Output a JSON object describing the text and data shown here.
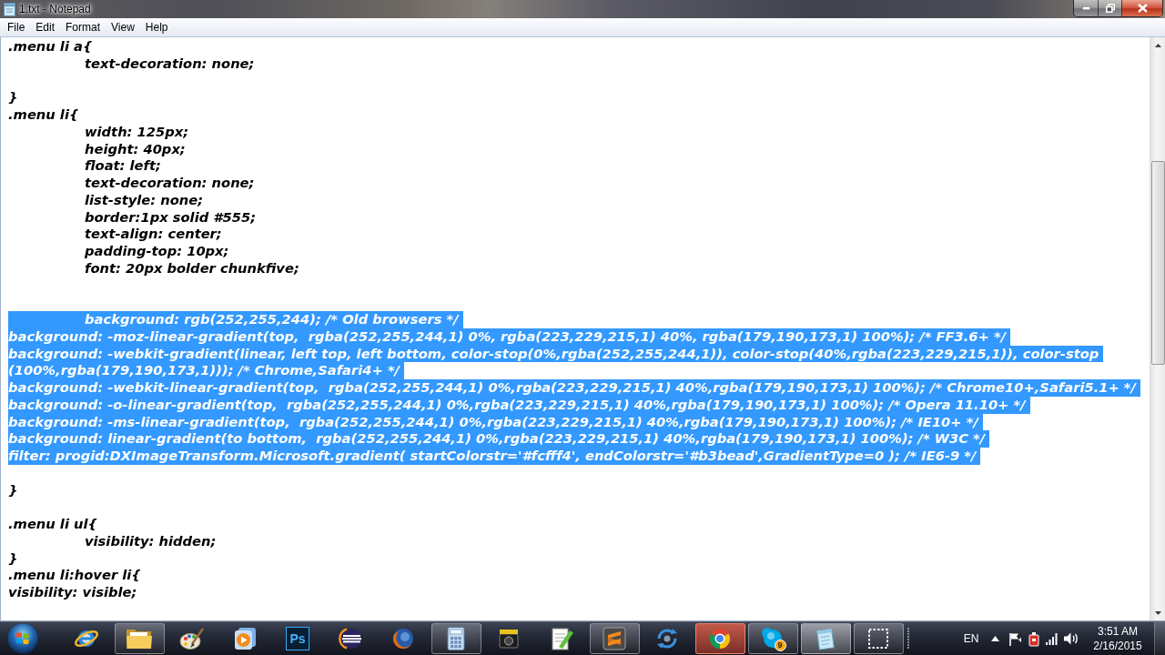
{
  "window": {
    "title": "1.txt - Notepad"
  },
  "menu_bar": [
    "File",
    "Edit",
    "Format",
    "View",
    "Help"
  ],
  "editor": {
    "lines": [
      {
        "text": ".menu li a{",
        "selected": false
      },
      {
        "text": "\ttext-decoration: none;",
        "selected": false
      },
      {
        "selected": false
      },
      {
        "text": "}",
        "selected": false
      },
      {
        "text": ".menu li{",
        "selected": false
      },
      {
        "text": "\twidth: 125px;",
        "selected": false
      },
      {
        "text": "\theight: 40px;",
        "selected": false
      },
      {
        "text": "\tfloat: left;",
        "selected": false
      },
      {
        "text": "\ttext-decoration: none;",
        "selected": false
      },
      {
        "text": "\tlist-style: none;",
        "selected": false
      },
      {
        "text": "\tborder:1px solid #555;",
        "selected": false
      },
      {
        "text": "\ttext-align: center;",
        "selected": false
      },
      {
        "text": "\tpadding-top: 10px;",
        "selected": false
      },
      {
        "text": "\tfont: 20px bolder chunkfive;",
        "selected": false
      },
      {
        "selected": false
      },
      {
        "selected": false
      },
      {
        "text": "\tbackground: rgb(252,255,244); /* Old browsers */",
        "selected": true
      },
      {
        "text": "background: -moz-linear-gradient(top,  rgba(252,255,244,1) 0%, rgba(223,229,215,1) 40%, rgba(179,190,173,1) 100%); /* FF3.6+ */",
        "selected": true
      },
      {
        "text": "background: -webkit-gradient(linear, left top, left bottom, color-stop(0%,rgba(252,255,244,1)), color-stop(40%,rgba(223,229,215,1)), color-stop",
        "selected": true
      },
      {
        "text": "(100%,rgba(179,190,173,1))); /* Chrome,Safari4+ */",
        "selected": true
      },
      {
        "text": "background: -webkit-linear-gradient(top,  rgba(252,255,244,1) 0%,rgba(223,229,215,1) 40%,rgba(179,190,173,1) 100%); /* Chrome10+,Safari5.1+ */",
        "selected": true
      },
      {
        "text": "background: -o-linear-gradient(top,  rgba(252,255,244,1) 0%,rgba(223,229,215,1) 40%,rgba(179,190,173,1) 100%); /* Opera 11.10+ */",
        "selected": true
      },
      {
        "text": "background: -ms-linear-gradient(top,  rgba(252,255,244,1) 0%,rgba(223,229,215,1) 40%,rgba(179,190,173,1) 100%); /* IE10+ */",
        "selected": true
      },
      {
        "text": "background: linear-gradient(to bottom,  rgba(252,255,244,1) 0%,rgba(223,229,215,1) 40%,rgba(179,190,173,1) 100%); /* W3C */",
        "selected": true
      },
      {
        "text": "filter: progid:DXImageTransform.Microsoft.gradient( startColorstr='#fcfff4', endColorstr='#b3bead',GradientType=0 ); /* IE6-9 */",
        "selected": true
      },
      {
        "selected": false
      },
      {
        "text": "}",
        "selected": false
      },
      {
        "selected": false
      },
      {
        "text": ".menu li ul{",
        "selected": false
      },
      {
        "text": "\tvisibility: hidden;",
        "selected": false
      },
      {
        "text": "}",
        "selected": false
      },
      {
        "text": ".menu li:hover li{",
        "selected": false
      },
      {
        "text": "visibility: visible;",
        "selected": false
      }
    ]
  },
  "taskbar": {
    "apps": [
      {
        "kind": "globe",
        "running": false,
        "active": false,
        "hovered": false
      },
      {
        "kind": "folder",
        "running": true,
        "active": false,
        "hovered": false
      },
      {
        "kind": "palette",
        "running": false,
        "active": false,
        "hovered": false
      },
      {
        "kind": "player",
        "running": false,
        "active": false,
        "hovered": false
      },
      {
        "kind": "tile",
        "label": "Ps",
        "running": false,
        "active": false,
        "hovered": false
      },
      {
        "kind": "stripes",
        "running": false,
        "active": false,
        "hovered": false
      },
      {
        "kind": "foxglobe",
        "running": false,
        "active": false,
        "hovered": false
      },
      {
        "kind": "calculator",
        "running": true,
        "active": false,
        "hovered": false
      },
      {
        "kind": "camera",
        "running": false,
        "active": false,
        "hovered": false
      },
      {
        "kind": "pen",
        "running": false,
        "active": false,
        "hovered": false
      },
      {
        "kind": "slant",
        "running": true,
        "active": false,
        "hovered": false
      },
      {
        "kind": "arrows",
        "running": false,
        "active": false,
        "hovered": false
      },
      {
        "kind": "wheel",
        "running": true,
        "active": false,
        "hovered": true
      },
      {
        "kind": "cloud",
        "badge": "9",
        "running": true,
        "active": false,
        "hovered": false
      },
      {
        "kind": "notepad",
        "running": true,
        "active": true,
        "hovered": false
      },
      {
        "kind": "dashed",
        "running": true,
        "active": false,
        "hovered": false
      }
    ],
    "tray": {
      "language": "EN",
      "time": "3:51 AM",
      "date": "2/16/2015"
    }
  }
}
